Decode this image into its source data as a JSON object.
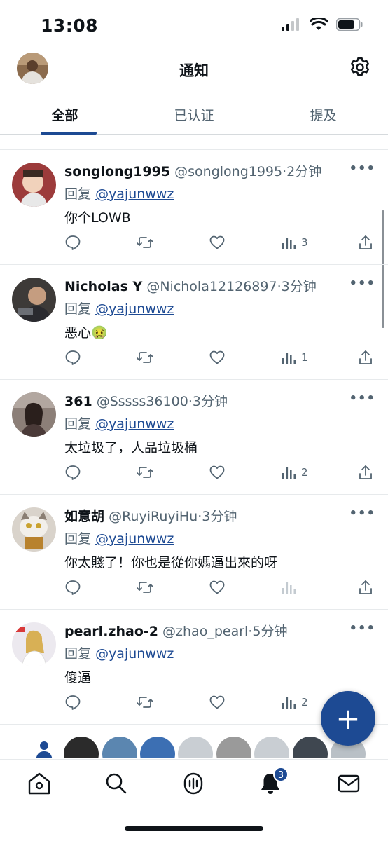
{
  "status_bar": {
    "time": "13:08"
  },
  "header": {
    "title": "通知"
  },
  "tabs": [
    {
      "label": "全部",
      "active": true
    },
    {
      "label": "已认证",
      "active": false
    },
    {
      "label": "提及",
      "active": false
    }
  ],
  "notifications": [
    {
      "name": "songlong1995",
      "handle": "@songlong1995",
      "time": "·2分钟",
      "reply_prefix": "回复",
      "reply_to": "@yajunwwz",
      "text": "你个LOWB",
      "views": "3"
    },
    {
      "name": "Nicholas Y",
      "handle": "@Nichola12126897",
      "time": "·3分钟",
      "reply_prefix": "回复",
      "reply_to": "@yajunwwz",
      "text": "恶心🤢",
      "views": "1"
    },
    {
      "name": "361",
      "handle": "@Sssss36100",
      "time": "·3分钟",
      "reply_prefix": "回复",
      "reply_to": "@yajunwwz",
      "text": "太垃圾了，人品垃圾桶",
      "views": "2"
    },
    {
      "name": "如意胡",
      "handle": "@RuyiRuyiHu",
      "time": "·3分钟",
      "reply_prefix": "回复",
      "reply_to": "@yajunwwz",
      "text": "你太賤了！你也是從你媽逼出來的呀",
      "views": ""
    },
    {
      "name": "pearl.zhao-2",
      "handle": "@zhao_pearl",
      "time": "·5分钟",
      "reply_prefix": "回复",
      "reply_to": "@yajunwwz",
      "text": "傻逼",
      "views": "2"
    }
  ],
  "fab": {
    "label": "+"
  },
  "bottom_nav": {
    "notifications_badge": "3"
  },
  "colors": {
    "accent": "#1d4a93",
    "secondary_text": "#536471",
    "divider": "#e7eaec"
  },
  "icons": [
    "home-icon",
    "search-icon",
    "spaces-icon",
    "bell-icon",
    "mail-icon",
    "gear-icon",
    "reply-icon",
    "retweet-icon",
    "heart-icon",
    "views-icon",
    "share-icon"
  ]
}
